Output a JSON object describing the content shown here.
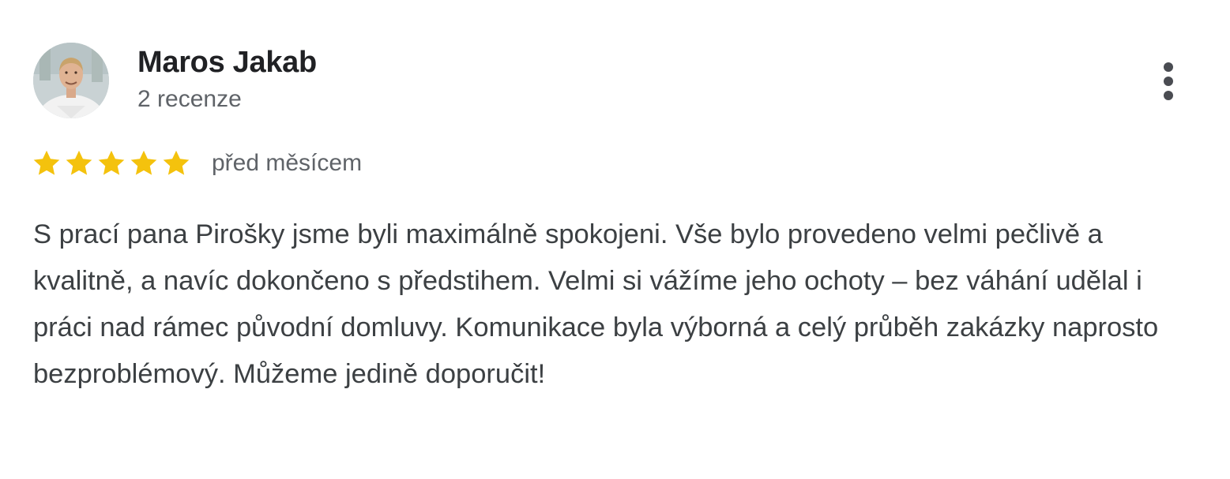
{
  "review": {
    "author_name": "Maros Jakab",
    "review_count": "2 recenze",
    "rating": 5,
    "rating_max": 5,
    "date": "před měsícem",
    "text": "S prací pana Pirošky jsme byli maximálně spokojeni. Vše bylo provedeno velmi pečlivě a kvalitně, a navíc dokončeno s předstihem. Velmi si vážíme jeho ochoty – bez váhání udělal i práci nad rámec původní domluvy. Komunikace byla výborná a celý průběh zakázky naprosto bezproblémový. Můžeme jedině doporučit!"
  },
  "icons": {
    "star": "star-icon",
    "more": "more-vert-icon"
  },
  "colors": {
    "star": "#f4c20d",
    "name": "#202124",
    "secondary": "#5f6368",
    "body": "#3c4043"
  }
}
